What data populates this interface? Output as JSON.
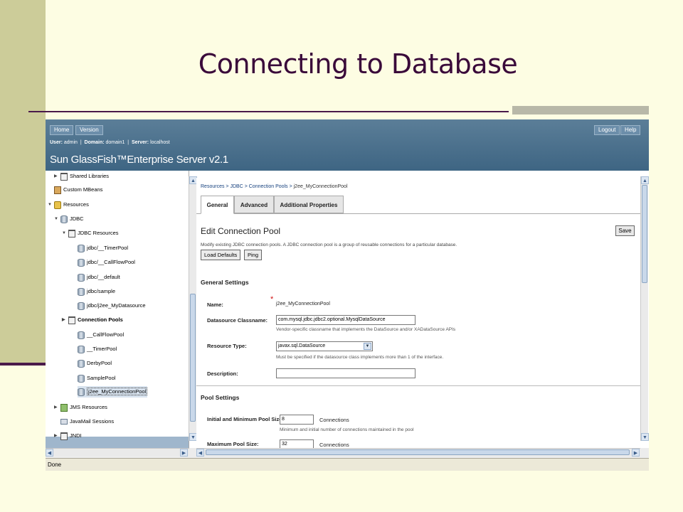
{
  "slide": {
    "title": "Connecting to Database"
  },
  "header": {
    "home_label": "Home",
    "version_label": "Version",
    "logout_label": "Logout",
    "help_label": "Help",
    "user_label": "User:",
    "user_value": "admin",
    "domain_label": "Domain:",
    "domain_value": "domain1",
    "server_label": "Server:",
    "server_value": "localhost",
    "product_name": "Sun GlassFish™Enterprise Server v2.1"
  },
  "tree": {
    "items": [
      {
        "label": "Shared Libraries",
        "icon": "folder-icon"
      },
      {
        "label": "Custom MBeans",
        "icon": "bean-icon"
      },
      {
        "label": "Resources",
        "icon": "resources-icon"
      },
      {
        "label": "JDBC",
        "icon": "database-icon"
      },
      {
        "label": "JDBC Resources",
        "icon": "folder-icon"
      },
      {
        "label": "jdbc/__TimerPool",
        "icon": "database-icon"
      },
      {
        "label": "jdbc/__CallFlowPool",
        "icon": "database-icon"
      },
      {
        "label": "jdbc/__default",
        "icon": "database-icon"
      },
      {
        "label": "jdbc/sample",
        "icon": "database-icon"
      },
      {
        "label": "jdbc/j2ee_MyDatasource",
        "icon": "database-icon"
      },
      {
        "label": "Connection Pools",
        "icon": "folder-icon"
      },
      {
        "label": "__CallFlowPool",
        "icon": "database-icon"
      },
      {
        "label": "__TimerPool",
        "icon": "database-icon"
      },
      {
        "label": "DerbyPool",
        "icon": "database-icon"
      },
      {
        "label": "SamplePool",
        "icon": "database-icon"
      },
      {
        "label": "j2ee_MyConnectionPool",
        "icon": "database-icon"
      },
      {
        "label": "JMS Resources",
        "icon": "jms-icon"
      },
      {
        "label": "JavaMail Sessions",
        "icon": "mail-icon"
      },
      {
        "label": "JNDI",
        "icon": "folder-icon"
      }
    ]
  },
  "content": {
    "breadcrumb": [
      "Resources",
      "JDBC",
      "Connection Pools",
      "j2ee_MyConnectionPool"
    ],
    "breadcrumb_separator": ">",
    "tabs": [
      "General",
      "Advanced",
      "Additional Properties"
    ],
    "active_tab": "General",
    "page_title": "Edit Connection Pool",
    "save_label": "Save",
    "description": "Modify existing JDBC connection pools. A JDBC connection pool is a group of reusable connections for a particular database.",
    "load_defaults_label": "Load Defaults",
    "ping_label": "Ping",
    "general_settings_title": "General Settings",
    "name_label": "Name:",
    "name_value": "j2ee_MyConnectionPool",
    "ds_classname_label": "Datasource Classname:",
    "ds_classname_required": "*",
    "ds_classname_value": "com.mysql.jdbc.jdbc2.optional.MysqlDataSource",
    "ds_classname_help": "Vendor-specific classname that implements the DataSource and/or XADataSource APIs",
    "resource_type_label": "Resource Type:",
    "resource_type_value": "javax.sql.DataSource",
    "resource_type_help": "Must be specified if the datasource class implements more than 1 of the interface.",
    "description_label": "Description:",
    "description_value": "",
    "pool_settings_title": "Pool Settings",
    "initial_pool_label": "Initial and Minimum Pool Size:",
    "initial_pool_value": "8",
    "initial_pool_unit": "Connections",
    "initial_pool_help": "Minimum and initial number of connections maintained in the pool",
    "max_pool_label": "Maximum Pool Size:",
    "max_pool_value": "32",
    "max_pool_unit": "Connections"
  },
  "status": {
    "text": "Done"
  }
}
